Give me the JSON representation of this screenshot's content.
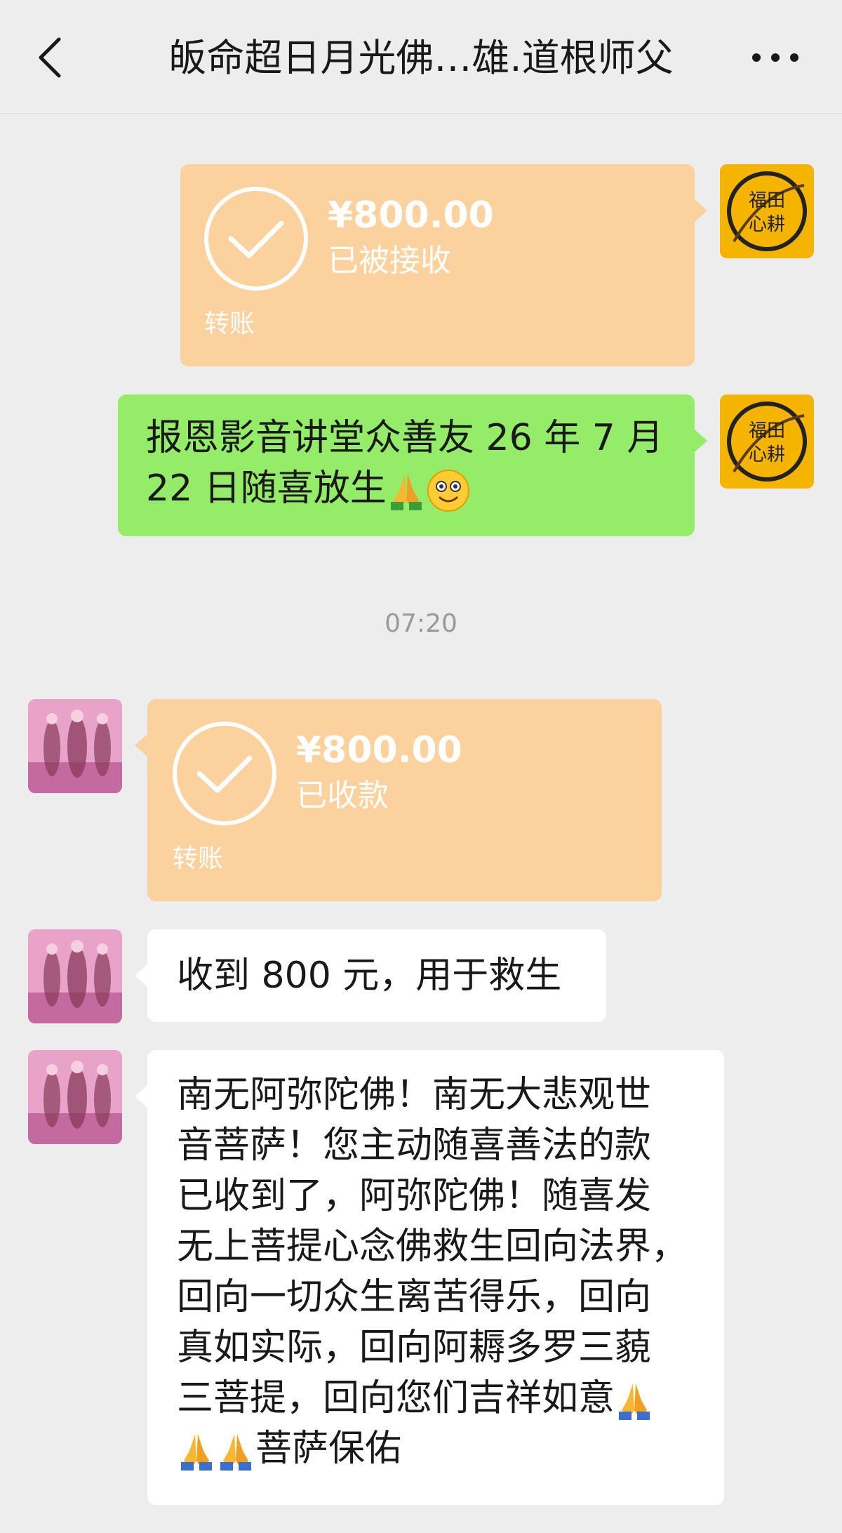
{
  "header": {
    "title": "皈命超日月光佛…雄.道根师父",
    "back_icon": "chevron-left-icon",
    "more_icon": "more-dots-icon"
  },
  "messages": {
    "sent_transfer": {
      "amount": "¥800.00",
      "status": "已被接收",
      "label": "转账"
    },
    "sent_text": {
      "line1": "报恩影音讲堂众善友 26 年 7 月",
      "line2": "22 日随喜放生"
    },
    "time": "07:20",
    "received_transfer": {
      "amount": "¥800.00",
      "status": "已收款",
      "label": "转账"
    },
    "received_text_1": "收到 800 元，用于救生",
    "received_text_2": {
      "lines": [
        "南无阿弥陀佛！南无大悲观世",
        "音菩萨！您主动随喜善法的款",
        "已收到了，阿弥陀佛！随喜发",
        "无上菩提心念佛救生回向法界，",
        "回向一切众生离苦得乐，回向",
        "真如实际，回向阿耨多罗三藐",
        "三菩提，回向您们吉祥如意",
        "菩萨保佑"
      ]
    }
  },
  "avatars": {
    "self_avatar_text": "福田心耕",
    "colors": {
      "self_bg": "#f4b400",
      "other_bg": "#e7a3c8"
    }
  },
  "colors": {
    "transfer": "#fbd19e",
    "green_bubble": "#95ec69",
    "white_bubble": "#ffffff",
    "background": "#ededed"
  }
}
